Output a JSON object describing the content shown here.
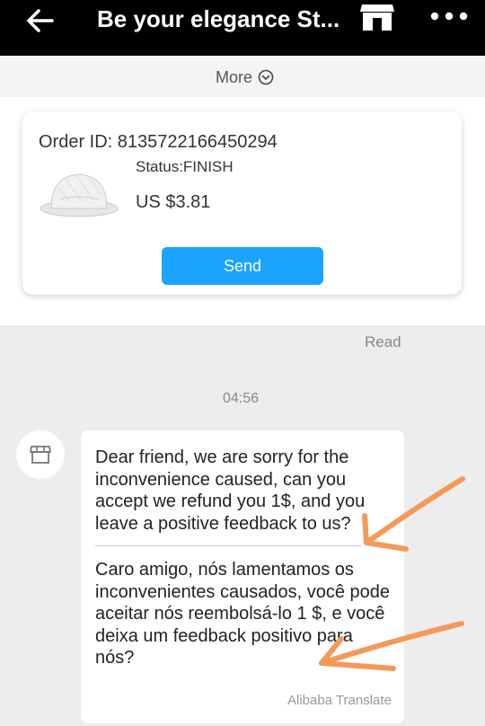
{
  "header": {
    "title": "Be your elegance St...",
    "icons": {
      "back": "arrow-left-icon",
      "store": "store-icon",
      "menu": "more-dots-icon"
    }
  },
  "more": {
    "label": "More",
    "icon": "chevron-down-circle-icon"
  },
  "order_card": {
    "order_id": "Order ID: 8135722166450294",
    "status": "Status:FINISH",
    "price": "US $3.81",
    "send_label": "Send",
    "product_image": "white-hat"
  },
  "read_status": "Read",
  "timestamp": "04:56",
  "message": {
    "avatar_icon": "store-icon",
    "text_en": "Dear friend, we are sorry for the inconvenience caused, can you accept we refund you 1$, and you leave a positive feedback to us?",
    "text_pt": "Caro amigo, nós lamentamos os inconvenientes causados, você pode aceitar nós reembolsá-lo 1 $, e você deixa um feedback positivo para nós?",
    "translate_label": "Alibaba Translate"
  },
  "colors": {
    "header_bg": "#000000",
    "send_button": "#1aa3ff",
    "annotation_arrow": "#f39a5a",
    "page_bg": "#ededed"
  }
}
